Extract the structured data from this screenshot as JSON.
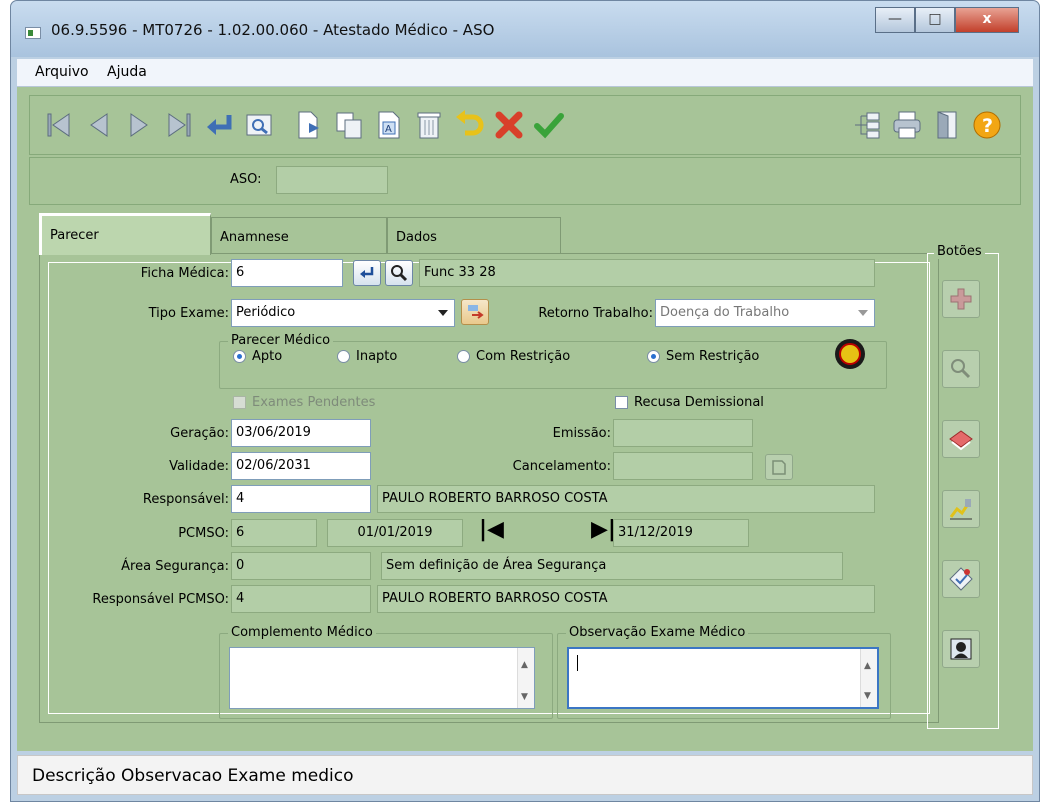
{
  "window": {
    "title": "06.9.5596 - MT0726 - 1.02.00.060 - Atestado Médico - ASO",
    "min_label": "—",
    "max_label": "□",
    "close_label": "x"
  },
  "menu": {
    "items": [
      {
        "label": "Arquivo"
      },
      {
        "label": "Ajuda"
      }
    ]
  },
  "toolbar": {
    "icons": [
      "first-record-icon",
      "previous-record-icon",
      "next-record-icon",
      "last-record-icon",
      "enter-icon",
      "preview-icon",
      "new-document-icon",
      "copy-icon",
      "edit-document-icon",
      "delete-icon",
      "undo-icon",
      "cancel-icon",
      "confirm-icon",
      "tree-icon",
      "print-icon",
      "exit-door-icon",
      "help-icon"
    ]
  },
  "aso": {
    "label": "ASO:",
    "value": ""
  },
  "tabs": [
    {
      "label": "Parecer"
    },
    {
      "label": "Anamnese"
    },
    {
      "label": "Dados"
    }
  ],
  "form": {
    "ficha_medica": {
      "label": "Ficha Médica:",
      "value": "6",
      "desc": "Func 33 28"
    },
    "tipo_exame": {
      "label": "Tipo Exame:",
      "value": "Periódico"
    },
    "retorno_trabalho": {
      "label": "Retorno Trabalho:",
      "value": "Doença do Trabalho"
    },
    "parecer_medico": {
      "title": "Parecer Médico",
      "options": [
        {
          "label": "Apto",
          "selected": true
        },
        {
          "label": "Inapto",
          "selected": false
        },
        {
          "label": "Com Restrição",
          "selected": false
        },
        {
          "label": "Sem Restrição",
          "selected": true
        }
      ]
    },
    "exames_pendentes": {
      "label": "Exames Pendentes",
      "checked": false,
      "disabled": true
    },
    "recusa_demissional": {
      "label": "Recusa Demissional",
      "checked": false
    },
    "geracao": {
      "label": "Geração:",
      "value": "03/06/2019"
    },
    "emissao": {
      "label": "Emissão:",
      "value": ""
    },
    "validade": {
      "label": "Validade:",
      "value": "02/06/2031"
    },
    "cancelamento": {
      "label": "Cancelamento:",
      "value": ""
    },
    "responsavel": {
      "label": "Responsável:",
      "value": "4",
      "name": "PAULO ROBERTO BARROSO COSTA"
    },
    "pcmso": {
      "label": "PCMSO:",
      "value": "6",
      "start": "01/01/2019",
      "end": "31/12/2019"
    },
    "area_seguranca": {
      "label": "Área Segurança:",
      "value": "0",
      "desc": "Sem definição de Área Segurança"
    },
    "responsavel_pcmso": {
      "label": "Responsável PCMSO:",
      "value": "4",
      "name": "PAULO ROBERTO BARROSO COSTA"
    },
    "complemento_medico": {
      "title": "Complemento Médico",
      "value": ""
    },
    "observacao_exame": {
      "title": "Observação Exame Médico",
      "value": ""
    }
  },
  "botoes": {
    "title": "Botões",
    "icons": [
      "add-icon",
      "search-person-icon",
      "book-icon",
      "chart-icon",
      "checklist-icon",
      "doctor-icon"
    ]
  },
  "status": {
    "text": "Descrição Observacao Exame medico"
  }
}
